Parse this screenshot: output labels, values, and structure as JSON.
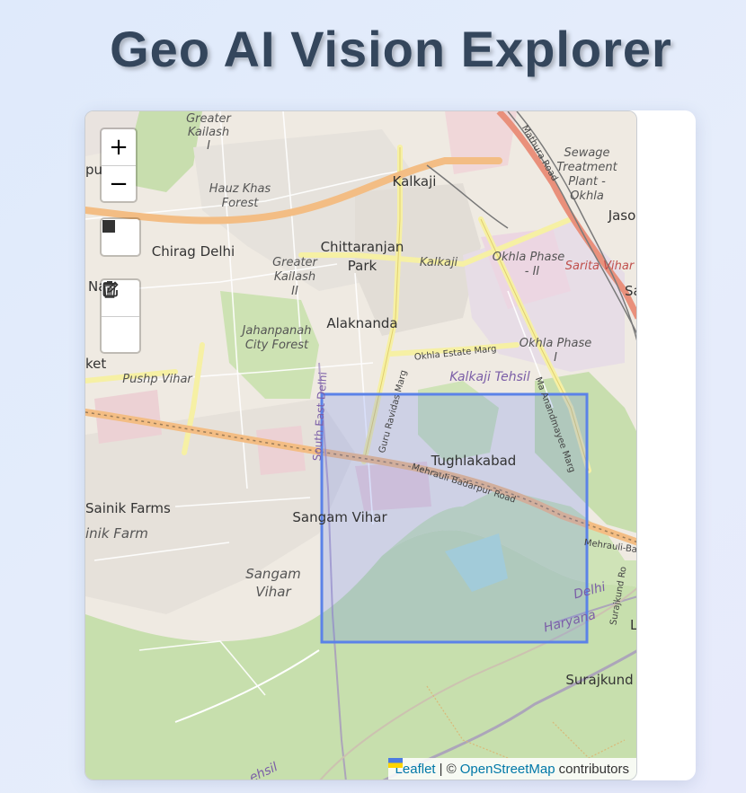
{
  "page": {
    "title": "Geo AI Vision Explorer"
  },
  "map": {
    "controls": {
      "zoom_in": "+",
      "zoom_out": "−"
    },
    "labels": {
      "greater_kailash_1": [
        "Greater",
        "Kailash",
        "I"
      ],
      "hauz_khas_forest": [
        "Hauz Khas",
        "Forest"
      ],
      "kalkaji": "Kalkaji",
      "kalkaji_small": "Kalkaji",
      "chirag_delhi": "Chirag Delhi",
      "chittaranjan_park": [
        "Chittaranjan",
        "Park"
      ],
      "greater_kailash_2": [
        "Greater",
        "Kailash",
        "II"
      ],
      "sewage_plant": [
        "Sewage",
        "Treatment",
        "Plant -",
        "Okhla"
      ],
      "jaso": "Jaso",
      "okhla_phase_2": [
        "Okhla Phase",
        "- II"
      ],
      "sarita_vihar": "Sarita Vihar",
      "okhla_phase_1": [
        "Okhla Phase",
        "I"
      ],
      "alaknanda": "Alaknanda",
      "jahanpanah": [
        "Jahanpanah",
        "City Forest"
      ],
      "okhla_estate_marg": "Okhla Estate Marg",
      "kalkaji_tehsil": "Kalkaji Tehsil",
      "pushp_vihar": "Pushp Vihar",
      "ket": "ket",
      "na": "Na",
      "pu": "pu",
      "sa": "Sa",
      "guru_ravidas_marg": "Guru Ravidas Marg",
      "south_east_delhi": "South East Delhi",
      "mathura_road": "Mathura Road",
      "ma_anandmayee_marg": "Ma Anandmayee Marg",
      "tughlakabad": "Tughlakabad",
      "mehrauli_badarpur_road": "Mehrauli Badarpur Road",
      "mehrauli_ba": "Mehrauli-Ba",
      "sainik_farms": "Sainik Farms",
      "sainik_farm_italic": "inik Farm",
      "sangam_vihar": "Sangam Vihar",
      "sangam_vihar_italic": [
        "Sangam",
        "Vihar"
      ],
      "delhi": "Delhi",
      "haryana": "Haryana",
      "surajkund_road": "Surajkund Ro",
      "surajkund": "Surajkund",
      "l": "L",
      "tehsil": "ehsil"
    },
    "selection": {
      "shape": "rectangle"
    },
    "attribution": {
      "leaflet": "Leaflet",
      "separator": "| ©",
      "osm": "OpenStreetMap",
      "contributors": "contributors"
    }
  },
  "icons": [
    "plus-icon",
    "minus-icon",
    "stop-square-icon",
    "edit-icon",
    "trash-icon",
    "ukraine-flag-icon"
  ],
  "colors": {
    "title": "#34465c",
    "selection": "#4f7ef0",
    "link": "#0078a8"
  }
}
